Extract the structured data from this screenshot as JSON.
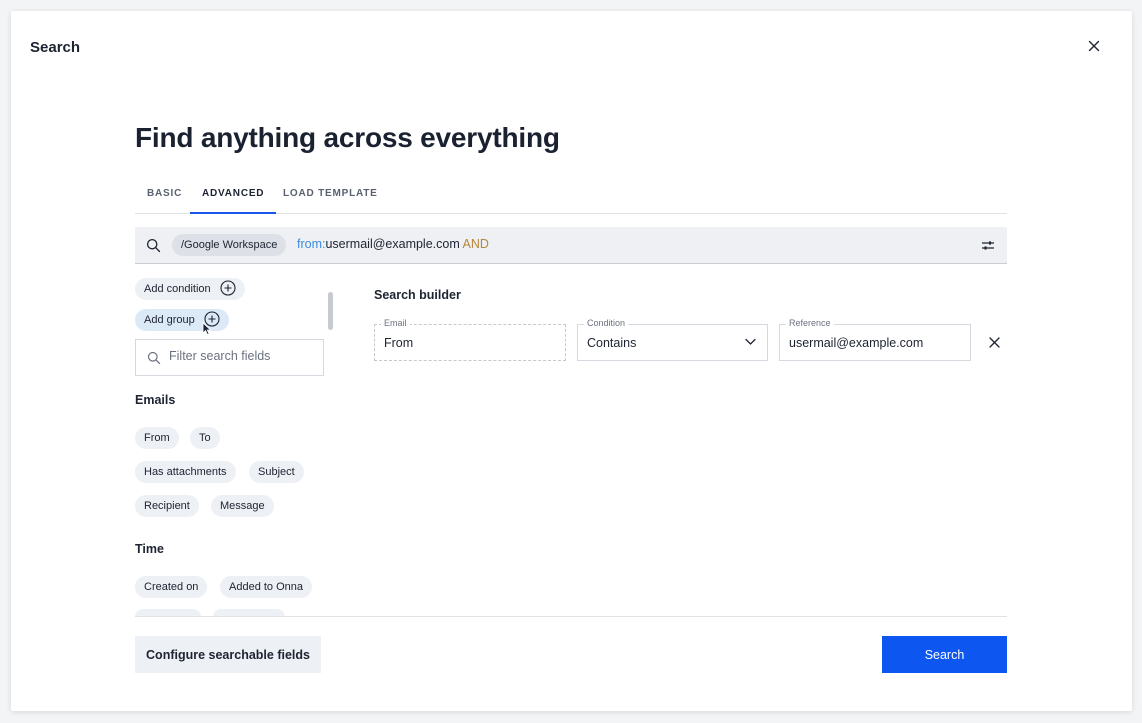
{
  "modal": {
    "title": "Search"
  },
  "headline": "Find anything across everything",
  "tabs": [
    {
      "label": "BASIC"
    },
    {
      "label": "ADVANCED"
    },
    {
      "label": "LOAD TEMPLATE"
    }
  ],
  "searchbar": {
    "source": "/Google Workspace",
    "field": "from:",
    "value": "usermail@example.com",
    "operator": "AND"
  },
  "actions": {
    "add_condition": "Add condition",
    "add_group": "Add group"
  },
  "filter": {
    "placeholder": "Filter search fields"
  },
  "sections": {
    "emails": {
      "title": "Emails",
      "items": [
        "From",
        "To",
        "Has attachments",
        "Subject",
        "Recipient",
        "Message"
      ]
    },
    "time": {
      "title": "Time",
      "items": [
        "Created on",
        "Added to Onna"
      ]
    }
  },
  "builder": {
    "title": "Search builder",
    "fields": [
      {
        "label": "Email",
        "value": "From"
      },
      {
        "label": "Condition",
        "value": "Contains"
      },
      {
        "label": "Reference",
        "value": "usermail@example.com"
      }
    ]
  },
  "footer": {
    "configure_label": "Configure searchable fields",
    "search_label": "Search"
  },
  "colors": {
    "primary": "#0d56ef",
    "tab_underline": "#1a56e8",
    "query_field": "#3b8de0",
    "query_operator": "#b8863b"
  }
}
